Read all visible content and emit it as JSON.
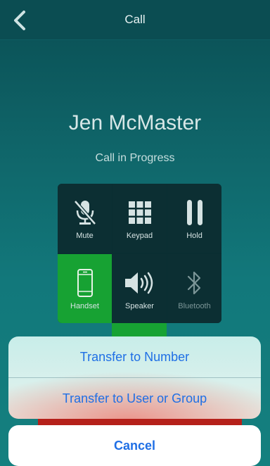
{
  "navbar": {
    "title": "Call",
    "back_icon": "chevron-left-icon"
  },
  "call": {
    "contact_name": "Jen McMaster",
    "status": "Call in Progress"
  },
  "controls": [
    {
      "label": "Mute",
      "icon": "microphone-muted-icon",
      "state": "default"
    },
    {
      "label": "Keypad",
      "icon": "keypad-icon",
      "state": "default"
    },
    {
      "label": "Hold",
      "icon": "pause-icon",
      "state": "default"
    },
    {
      "label": "Handset",
      "icon": "phone-handset-icon",
      "state": "active"
    },
    {
      "label": "Speaker",
      "icon": "speaker-icon",
      "state": "default"
    },
    {
      "label": "Bluetooth",
      "icon": "bluetooth-icon",
      "state": "disabled"
    }
  ],
  "action_sheet": {
    "options": [
      "Transfer to Number",
      "Transfer to User or Group"
    ],
    "cancel_label": "Cancel"
  },
  "colors": {
    "accent_blue": "#1f6fe5",
    "active_green": "#17a233",
    "background_teal": "#0f6468",
    "end_call_red": "#b5201a"
  }
}
